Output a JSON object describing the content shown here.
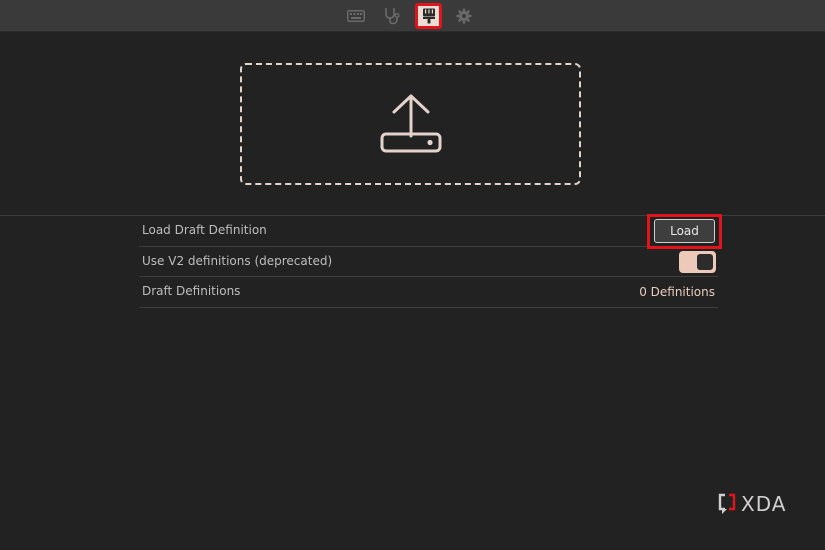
{
  "toolbar": {
    "icons": [
      "keyboard-icon",
      "stethoscope-icon",
      "paintbrush-icon",
      "gear-icon"
    ],
    "active_icon": "paintbrush-icon",
    "highlight_color": "#e1141c"
  },
  "dropzone": {
    "icon": "upload-icon",
    "border_color": "#e4d3cb"
  },
  "settings": {
    "load_draft_label": "Load Draft Definition",
    "load_button_label": "Load",
    "v2_label": "Use V2 definitions (deprecated)",
    "v2_enabled": true,
    "draft_defs_label": "Draft Definitions",
    "draft_defs_value": "0 Definitions"
  },
  "watermark": {
    "text": "XDA"
  },
  "colors": {
    "background": "#222222",
    "toolbar": "#3a3a3a",
    "accent": "#ecc9b8",
    "annotation": "#e1141c"
  }
}
